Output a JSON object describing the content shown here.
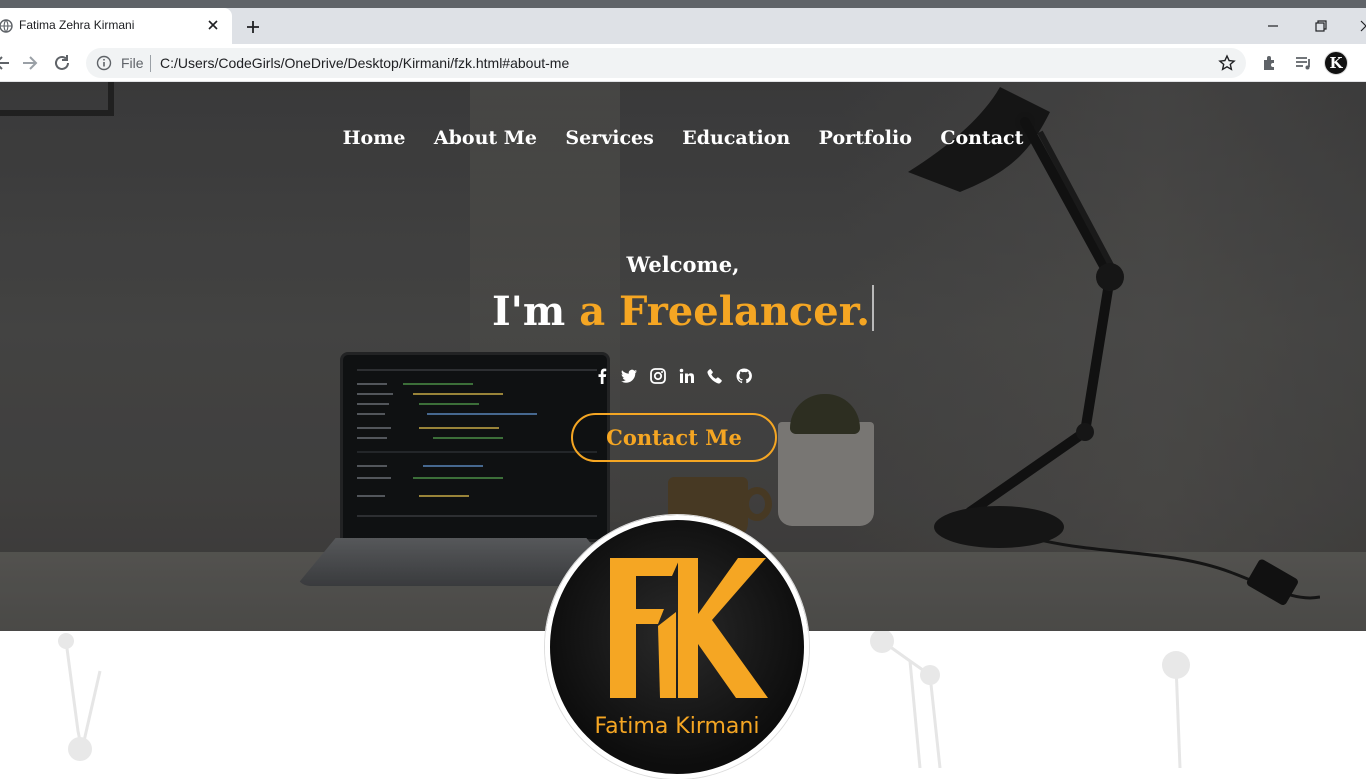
{
  "browser": {
    "tab_title": "Fatima Zehra Kirmani",
    "security_label": "File",
    "url": "C:/Users/CodeGirls/OneDrive/Desktop/Kirmani/fzk.html#about-me",
    "profile_initial": "K"
  },
  "nav": {
    "items": [
      "Home",
      "About Me",
      "Services",
      "Education",
      "Portfolio",
      "Contact"
    ]
  },
  "hero": {
    "welcome": "Welcome,",
    "tagline_prefix": "I'm",
    "tagline_role": "a Freelancer.",
    "socials": [
      "facebook-icon",
      "twitter-icon",
      "instagram-icon",
      "linkedin-icon",
      "phone-icon",
      "github-icon"
    ],
    "cta_label": "Contact Me"
  },
  "logo": {
    "name": "Fatima Kirmani"
  },
  "colors": {
    "accent": "#f5a623",
    "hero_text": "#ffffff"
  }
}
